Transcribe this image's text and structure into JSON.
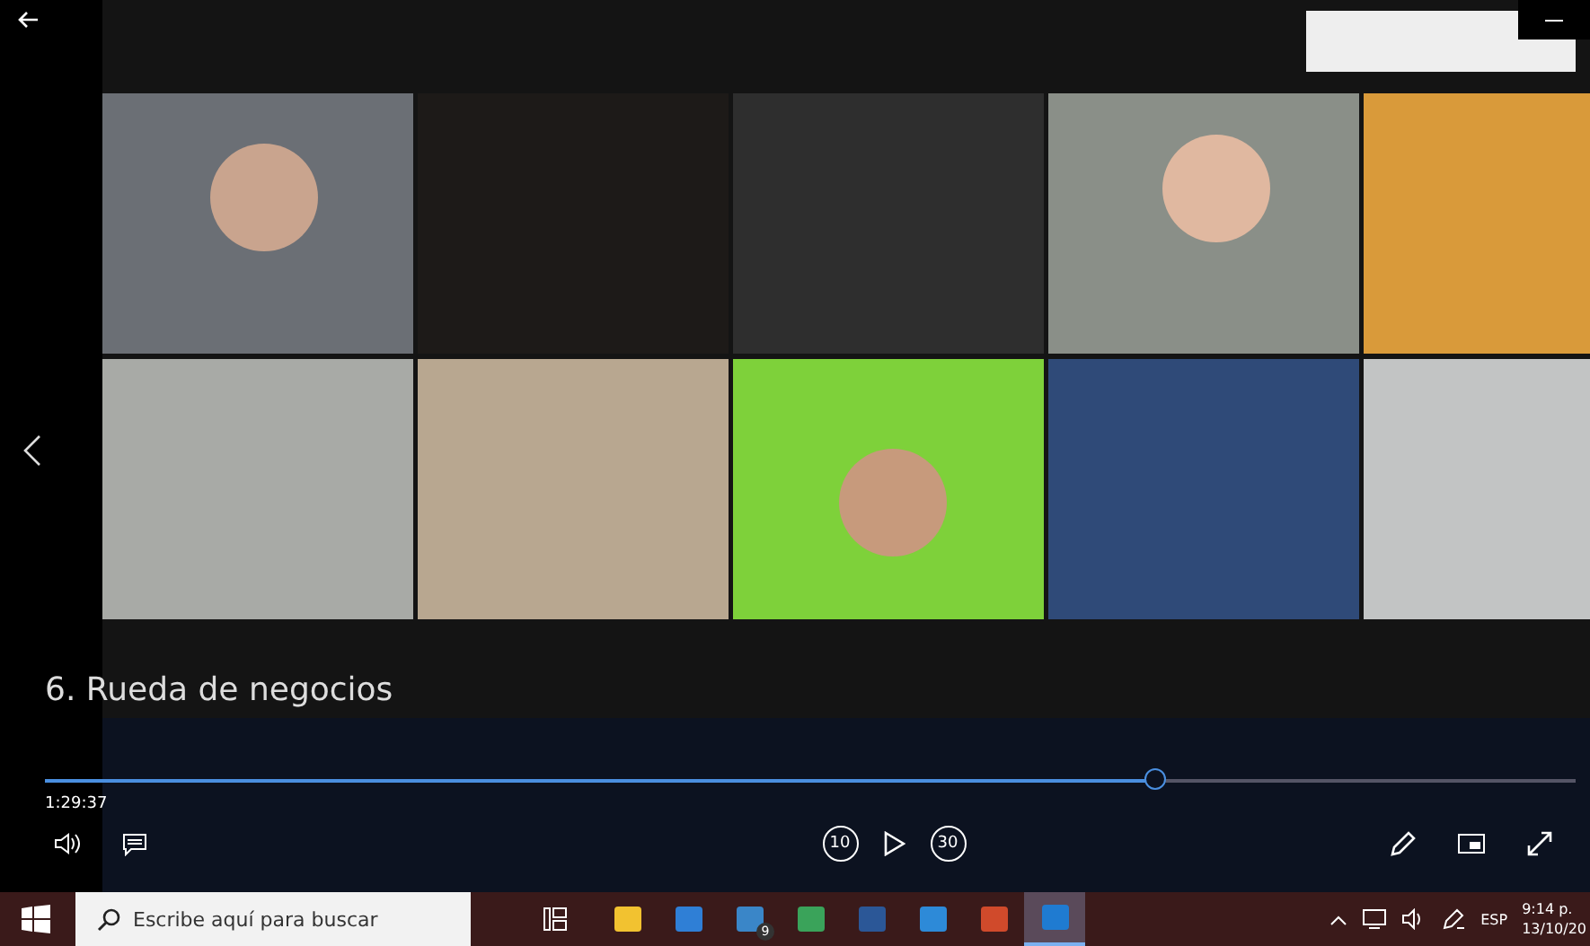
{
  "player": {
    "title": "6. Rueda de negocios",
    "elapsed": "1:29:37",
    "skip_back": "10",
    "skip_forward": "30",
    "playing": false
  },
  "seek": {
    "level": 0.725
  },
  "taskbar": {
    "search": {
      "placeholder": "Escribe aquí para buscar"
    },
    "apps": [
      {
        "kind": "explorer",
        "active": false
      },
      {
        "kind": "store",
        "active": false
      },
      {
        "kind": "mail",
        "active": false,
        "badge": "9"
      },
      {
        "kind": "chrome",
        "active": false
      },
      {
        "kind": "word",
        "active": false
      },
      {
        "kind": "photos",
        "active": false
      },
      {
        "kind": "powerpoint",
        "active": false
      },
      {
        "kind": "movies",
        "active": true
      }
    ],
    "language": "ESP",
    "time": "9:14 p.",
    "date": "13/10/20"
  }
}
